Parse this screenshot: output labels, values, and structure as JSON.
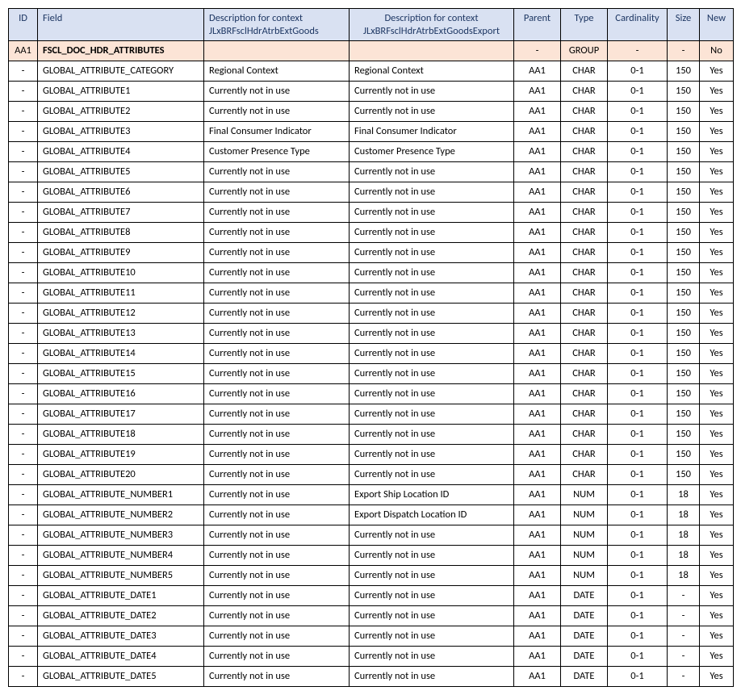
{
  "columns": {
    "id": "ID",
    "field": "Field",
    "desc1": "Description for context JLxBRFsclHdrAtrbExtGoods",
    "desc2": "Description for context JLxBRFsclHdrAtrbExtGoodsExport",
    "parent": "Parent",
    "type": "Type",
    "cardinality": "Cardinality",
    "size": "Size",
    "new": "New"
  },
  "rows": [
    {
      "group": true,
      "id": "AA1",
      "field": "FSCL_DOC_HDR_ATTRIBUTES",
      "desc1": "",
      "desc2": "",
      "parent": "-",
      "type": "GROUP",
      "cardinality": "-",
      "size": "-",
      "new": "No"
    },
    {
      "group": false,
      "id": "-",
      "field": "GLOBAL_ATTRIBUTE_CATEGORY",
      "desc1": "Regional Context",
      "desc2": "Regional Context",
      "parent": "AA1",
      "type": "CHAR",
      "cardinality": "0-1",
      "size": "150",
      "new": "Yes"
    },
    {
      "group": false,
      "id": "-",
      "field": "GLOBAL_ATTRIBUTE1",
      "desc1": "Currently not in use",
      "desc2": "Currently not in use",
      "parent": "AA1",
      "type": "CHAR",
      "cardinality": "0-1",
      "size": "150",
      "new": "Yes"
    },
    {
      "group": false,
      "id": "-",
      "field": "GLOBAL_ATTRIBUTE2",
      "desc1": "Currently not in use",
      "desc2": "Currently not in use",
      "parent": "AA1",
      "type": "CHAR",
      "cardinality": "0-1",
      "size": "150",
      "new": "Yes"
    },
    {
      "group": false,
      "id": "-",
      "field": "GLOBAL_ATTRIBUTE3",
      "desc1": "Final Consumer Indicator",
      "desc2": "Final Consumer Indicator",
      "parent": "AA1",
      "type": "CHAR",
      "cardinality": "0-1",
      "size": "150",
      "new": "Yes"
    },
    {
      "group": false,
      "id": "-",
      "field": "GLOBAL_ATTRIBUTE4",
      "desc1": "Customer Presence Type",
      "desc2": "Customer Presence Type",
      "parent": "AA1",
      "type": "CHAR",
      "cardinality": "0-1",
      "size": "150",
      "new": "Yes"
    },
    {
      "group": false,
      "id": "-",
      "field": "GLOBAL_ATTRIBUTE5",
      "desc1": "Currently not in use",
      "desc2": "Currently not in use",
      "parent": "AA1",
      "type": "CHAR",
      "cardinality": "0-1",
      "size": "150",
      "new": "Yes"
    },
    {
      "group": false,
      "id": "-",
      "field": "GLOBAL_ATTRIBUTE6",
      "desc1": "Currently not in use",
      "desc2": "Currently not in use",
      "parent": "AA1",
      "type": "CHAR",
      "cardinality": "0-1",
      "size": "150",
      "new": "Yes"
    },
    {
      "group": false,
      "id": "-",
      "field": "GLOBAL_ATTRIBUTE7",
      "desc1": "Currently not in use",
      "desc2": "Currently not in use",
      "parent": "AA1",
      "type": "CHAR",
      "cardinality": "0-1",
      "size": "150",
      "new": "Yes"
    },
    {
      "group": false,
      "id": "-",
      "field": "GLOBAL_ATTRIBUTE8",
      "desc1": "Currently not in use",
      "desc2": "Currently not in use",
      "parent": "AA1",
      "type": "CHAR",
      "cardinality": "0-1",
      "size": "150",
      "new": "Yes"
    },
    {
      "group": false,
      "id": "-",
      "field": "GLOBAL_ATTRIBUTE9",
      "desc1": "Currently not in use",
      "desc2": "Currently not in use",
      "parent": "AA1",
      "type": "CHAR",
      "cardinality": "0-1",
      "size": "150",
      "new": "Yes"
    },
    {
      "group": false,
      "id": "-",
      "field": "GLOBAL_ATTRIBUTE10",
      "desc1": "Currently not in use",
      "desc2": "Currently not in use",
      "parent": "AA1",
      "type": "CHAR",
      "cardinality": "0-1",
      "size": "150",
      "new": "Yes"
    },
    {
      "group": false,
      "id": "-",
      "field": "GLOBAL_ATTRIBUTE11",
      "desc1": "Currently not in use",
      "desc2": "Currently not in use",
      "parent": "AA1",
      "type": "CHAR",
      "cardinality": "0-1",
      "size": "150",
      "new": "Yes"
    },
    {
      "group": false,
      "id": "-",
      "field": "GLOBAL_ATTRIBUTE12",
      "desc1": "Currently not in use",
      "desc2": "Currently not in use",
      "parent": "AA1",
      "type": "CHAR",
      "cardinality": "0-1",
      "size": "150",
      "new": "Yes"
    },
    {
      "group": false,
      "id": "-",
      "field": "GLOBAL_ATTRIBUTE13",
      "desc1": "Currently not in use",
      "desc2": "Currently not in use",
      "parent": "AA1",
      "type": "CHAR",
      "cardinality": "0-1",
      "size": "150",
      "new": "Yes"
    },
    {
      "group": false,
      "id": "-",
      "field": "GLOBAL_ATTRIBUTE14",
      "desc1": "Currently not in use",
      "desc2": "Currently not in use",
      "parent": "AA1",
      "type": "CHAR",
      "cardinality": "0-1",
      "size": "150",
      "new": "Yes"
    },
    {
      "group": false,
      "id": "-",
      "field": "GLOBAL_ATTRIBUTE15",
      "desc1": "Currently not in use",
      "desc2": "Currently not in use",
      "parent": "AA1",
      "type": "CHAR",
      "cardinality": "0-1",
      "size": "150",
      "new": "Yes"
    },
    {
      "group": false,
      "id": "-",
      "field": "GLOBAL_ATTRIBUTE16",
      "desc1": "Currently not in use",
      "desc2": "Currently not in use",
      "parent": "AA1",
      "type": "CHAR",
      "cardinality": "0-1",
      "size": "150",
      "new": "Yes"
    },
    {
      "group": false,
      "id": "-",
      "field": "GLOBAL_ATTRIBUTE17",
      "desc1": "Currently not in use",
      "desc2": "Currently not in use",
      "parent": "AA1",
      "type": "CHAR",
      "cardinality": "0-1",
      "size": "150",
      "new": "Yes"
    },
    {
      "group": false,
      "id": "-",
      "field": "GLOBAL_ATTRIBUTE18",
      "desc1": "Currently not in use",
      "desc2": "Currently not in use",
      "parent": "AA1",
      "type": "CHAR",
      "cardinality": "0-1",
      "size": "150",
      "new": "Yes"
    },
    {
      "group": false,
      "id": "-",
      "field": "GLOBAL_ATTRIBUTE19",
      "desc1": "Currently not in use",
      "desc2": "Currently not in use",
      "parent": "AA1",
      "type": "CHAR",
      "cardinality": "0-1",
      "size": "150",
      "new": "Yes"
    },
    {
      "group": false,
      "id": "-",
      "field": "GLOBAL_ATTRIBUTE20",
      "desc1": "Currently not in use",
      "desc2": "Currently not in use",
      "parent": "AA1",
      "type": "CHAR",
      "cardinality": "0-1",
      "size": "150",
      "new": "Yes"
    },
    {
      "group": false,
      "id": "-",
      "field": "GLOBAL_ATTRIBUTE_NUMBER1",
      "desc1": "Currently not in use",
      "desc2": "Export Ship Location ID",
      "parent": "AA1",
      "type": "NUM",
      "cardinality": "0-1",
      "size": "18",
      "new": "Yes"
    },
    {
      "group": false,
      "id": "-",
      "field": "GLOBAL_ATTRIBUTE_NUMBER2",
      "desc1": "Currently not in use",
      "desc2": "Export Dispatch Location ID",
      "parent": "AA1",
      "type": "NUM",
      "cardinality": "0-1",
      "size": "18",
      "new": "Yes"
    },
    {
      "group": false,
      "id": "-",
      "field": "GLOBAL_ATTRIBUTE_NUMBER3",
      "desc1": "Currently not in use",
      "desc2": "Currently not in use",
      "parent": "AA1",
      "type": "NUM",
      "cardinality": "0-1",
      "size": "18",
      "new": "Yes"
    },
    {
      "group": false,
      "id": "-",
      "field": "GLOBAL_ATTRIBUTE_NUMBER4",
      "desc1": "Currently not in use",
      "desc2": "Currently not in use",
      "parent": "AA1",
      "type": "NUM",
      "cardinality": "0-1",
      "size": "18",
      "new": "Yes"
    },
    {
      "group": false,
      "id": "-",
      "field": "GLOBAL_ATTRIBUTE_NUMBER5",
      "desc1": "Currently not in use",
      "desc2": "Currently not in use",
      "parent": "AA1",
      "type": "NUM",
      "cardinality": "0-1",
      "size": "18",
      "new": "Yes"
    },
    {
      "group": false,
      "id": "-",
      "field": "GLOBAL_ATTRIBUTE_DATE1",
      "desc1": "Currently not in use",
      "desc2": "Currently not in use",
      "parent": "AA1",
      "type": "DATE",
      "cardinality": "0-1",
      "size": "-",
      "new": "Yes"
    },
    {
      "group": false,
      "id": "-",
      "field": "GLOBAL_ATTRIBUTE_DATE2",
      "desc1": "Currently not in use",
      "desc2": "Currently not in use",
      "parent": "AA1",
      "type": "DATE",
      "cardinality": "0-1",
      "size": "-",
      "new": "Yes"
    },
    {
      "group": false,
      "id": "-",
      "field": "GLOBAL_ATTRIBUTE_DATE3",
      "desc1": "Currently not in use",
      "desc2": "Currently not in use",
      "parent": "AA1",
      "type": "DATE",
      "cardinality": "0-1",
      "size": "-",
      "new": "Yes"
    },
    {
      "group": false,
      "id": "-",
      "field": "GLOBAL_ATTRIBUTE_DATE4",
      "desc1": "Currently not in use",
      "desc2": "Currently not in use",
      "parent": "AA1",
      "type": "DATE",
      "cardinality": "0-1",
      "size": "-",
      "new": "Yes"
    },
    {
      "group": false,
      "id": "-",
      "field": "GLOBAL_ATTRIBUTE_DATE5",
      "desc1": "Currently not in use",
      "desc2": "Currently not in use",
      "parent": "AA1",
      "type": "DATE",
      "cardinality": "0-1",
      "size": "-",
      "new": "Yes"
    }
  ]
}
